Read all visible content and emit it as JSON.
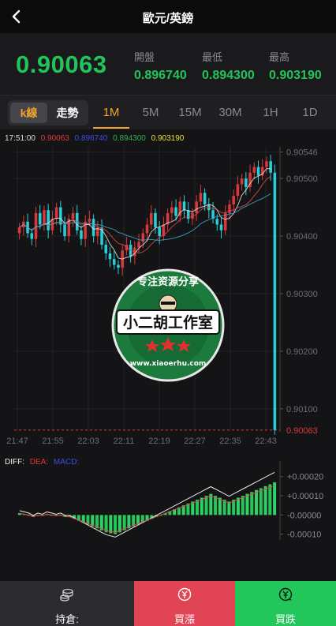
{
  "header": {
    "title": "歐元/英鎊",
    "back_icon": "chevron-left-icon"
  },
  "quote": {
    "price": "0.90063",
    "open_label": "開盤",
    "open_value": "0.896740",
    "low_label": "最低",
    "low_value": "0.894300",
    "high_label": "最高",
    "high_value": "0.903190",
    "up_color": "#21c45a"
  },
  "tabs": {
    "kline_label": "k線",
    "trend_label": "走勢",
    "timeframes": [
      "1M",
      "5M",
      "15M",
      "30M",
      "1H",
      "1D"
    ],
    "active_timeframe": "1M"
  },
  "legend": {
    "time": "17:51:00",
    "v1": "0.90063",
    "v2": "0.896740",
    "v3": "0.894300",
    "v4": "0.903190"
  },
  "chart_data": [
    {
      "type": "candlestick",
      "y_ticks": [
        "0.90546",
        "0.90500",
        "0.90400",
        "0.90300",
        "0.90200",
        "0.90100"
      ],
      "current_price_label": "0.90063",
      "x_ticks": [
        "21:47",
        "21:55",
        "22:03",
        "22:11",
        "22:19",
        "22:27",
        "22:35",
        "22:43"
      ],
      "ylim": [
        0.9006,
        0.90555
      ],
      "closes": [
        0.90415,
        0.90425,
        0.90405,
        0.90395,
        0.9044,
        0.9042,
        0.90445,
        0.9041,
        0.9043,
        0.9045,
        0.9042,
        0.904,
        0.9043,
        0.9044,
        0.9041,
        0.90395,
        0.90425,
        0.9043,
        0.904,
        0.90415,
        0.90385,
        0.9037,
        0.9036,
        0.9035,
        0.90345,
        0.90375,
        0.90385,
        0.90365,
        0.9038,
        0.9039,
        0.90405,
        0.9042,
        0.9044,
        0.90415,
        0.904,
        0.9042,
        0.9044,
        0.9045,
        0.90435,
        0.9046,
        0.90445,
        0.9043,
        0.9044,
        0.9046,
        0.90475,
        0.90455,
        0.90445,
        0.9043,
        0.9042,
        0.9041,
        0.9044,
        0.90455,
        0.9047,
        0.9049,
        0.905,
        0.90485,
        0.9051,
        0.9052,
        0.90505,
        0.9052,
        0.9053,
        0.9051,
        0.90063
      ],
      "colors": {
        "up": "#d8393a",
        "down": "#29cfd6"
      }
    },
    {
      "type": "bar",
      "indicator": "MACD",
      "y_ticks": [
        "+0.00020",
        "+0.00010",
        "-0.00000",
        "-0.00010"
      ],
      "ylim": [
        -0.00013,
        0.00024
      ],
      "values": [
        1e-05,
        5e-06,
        0.0,
        -1e-05,
        0.0,
        -5e-06,
        5e-06,
        0.0,
        -5e-06,
        0.0,
        -1e-05,
        -1e-05,
        -2e-05,
        -3e-05,
        -4e-05,
        -5e-05,
        -6e-05,
        -7e-05,
        -8e-05,
        -9e-05,
        -9.5e-05,
        -0.0001,
        -9e-05,
        -8e-05,
        -7e-05,
        -6e-05,
        -5e-05,
        -4e-05,
        -3e-05,
        -2e-05,
        -1e-05,
        0.0,
        1e-05,
        2e-05,
        3e-05,
        4e-05,
        5e-05,
        6e-05,
        7e-05,
        8e-05,
        9e-05,
        0.0001,
        0.00011,
        0.0001,
        9e-05,
        8e-05,
        7e-05,
        8e-05,
        9e-05,
        0.0001,
        0.00011,
        0.00012,
        0.00013,
        0.00014,
        0.00015,
        0.00016,
        0.00017
      ],
      "series": [
        {
          "name": "DIFF:"
        },
        {
          "name": "DEA:"
        },
        {
          "name": "MACD:"
        }
      ]
    }
  ],
  "macd_legend": {
    "diff": "DIFF:",
    "dea": "DEA:",
    "macd": "MACD:"
  },
  "watermark": {
    "top_text": "专注资源分享",
    "main_text": "小二胡工作室",
    "url_text": "www.xiaoerhu.com"
  },
  "bottom": {
    "hold_label": "持倉:",
    "buy_up_label": "買漲",
    "buy_down_label": "買跌",
    "hold_color": "#2b2b30",
    "up_color": "#e04455",
    "down_color": "#22c65a"
  }
}
